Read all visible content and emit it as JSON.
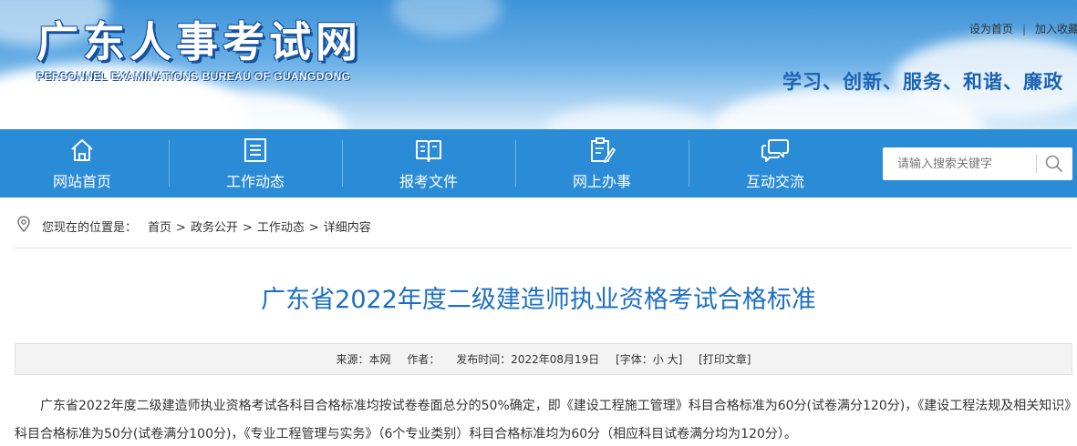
{
  "header": {
    "logo_title": "广东人事考试网",
    "logo_subtitle": "PERSONNEL EXAMINATIONS BUREAU OF GUANGDONG",
    "links": [
      "设为首页",
      "加入收藏"
    ],
    "slogan": "学习、创新、服务、和谐、廉政"
  },
  "nav": {
    "items": [
      {
        "label": "网站首页",
        "icon": "home-icon"
      },
      {
        "label": "工作动态",
        "icon": "news-list-icon"
      },
      {
        "label": "报考文件",
        "icon": "open-book-icon"
      },
      {
        "label": "网上办事",
        "icon": "clipboard-edit-icon"
      },
      {
        "label": "互动交流",
        "icon": "chat-bubbles-icon"
      }
    ],
    "search_placeholder": "请输入搜索关键字"
  },
  "breadcrumb": {
    "lead": "您现在的位置是：",
    "items": [
      "首页",
      "政务公开",
      "工作动态",
      "详细内容"
    ]
  },
  "article": {
    "title": "广东省2022年度二级建造师执业资格考试合格标准",
    "meta": {
      "source": "来源：本网",
      "author": "作者：",
      "date": "发布时间：2022年08月19日",
      "font": "[字体：小 大]",
      "print": "[打印文章]"
    },
    "body": "广东省2022年度二级建造师执业资格考试各科目合格标准均按试卷卷面总分的50%确定，即《建设工程施工管理》科目合格标准为60分(试卷满分120分)，《建设工程法规及相关知识》科目合格标准为50分(试卷满分100分)，《专业工程管理与实务》（6个专业类别）科目合格标准均为60分（相应科目试卷满分均为120分）。"
  },
  "colors": {
    "nav_bg": "#2a8bd6",
    "title_blue": "#1d6fc4",
    "slogan_blue": "#1b63b3"
  }
}
